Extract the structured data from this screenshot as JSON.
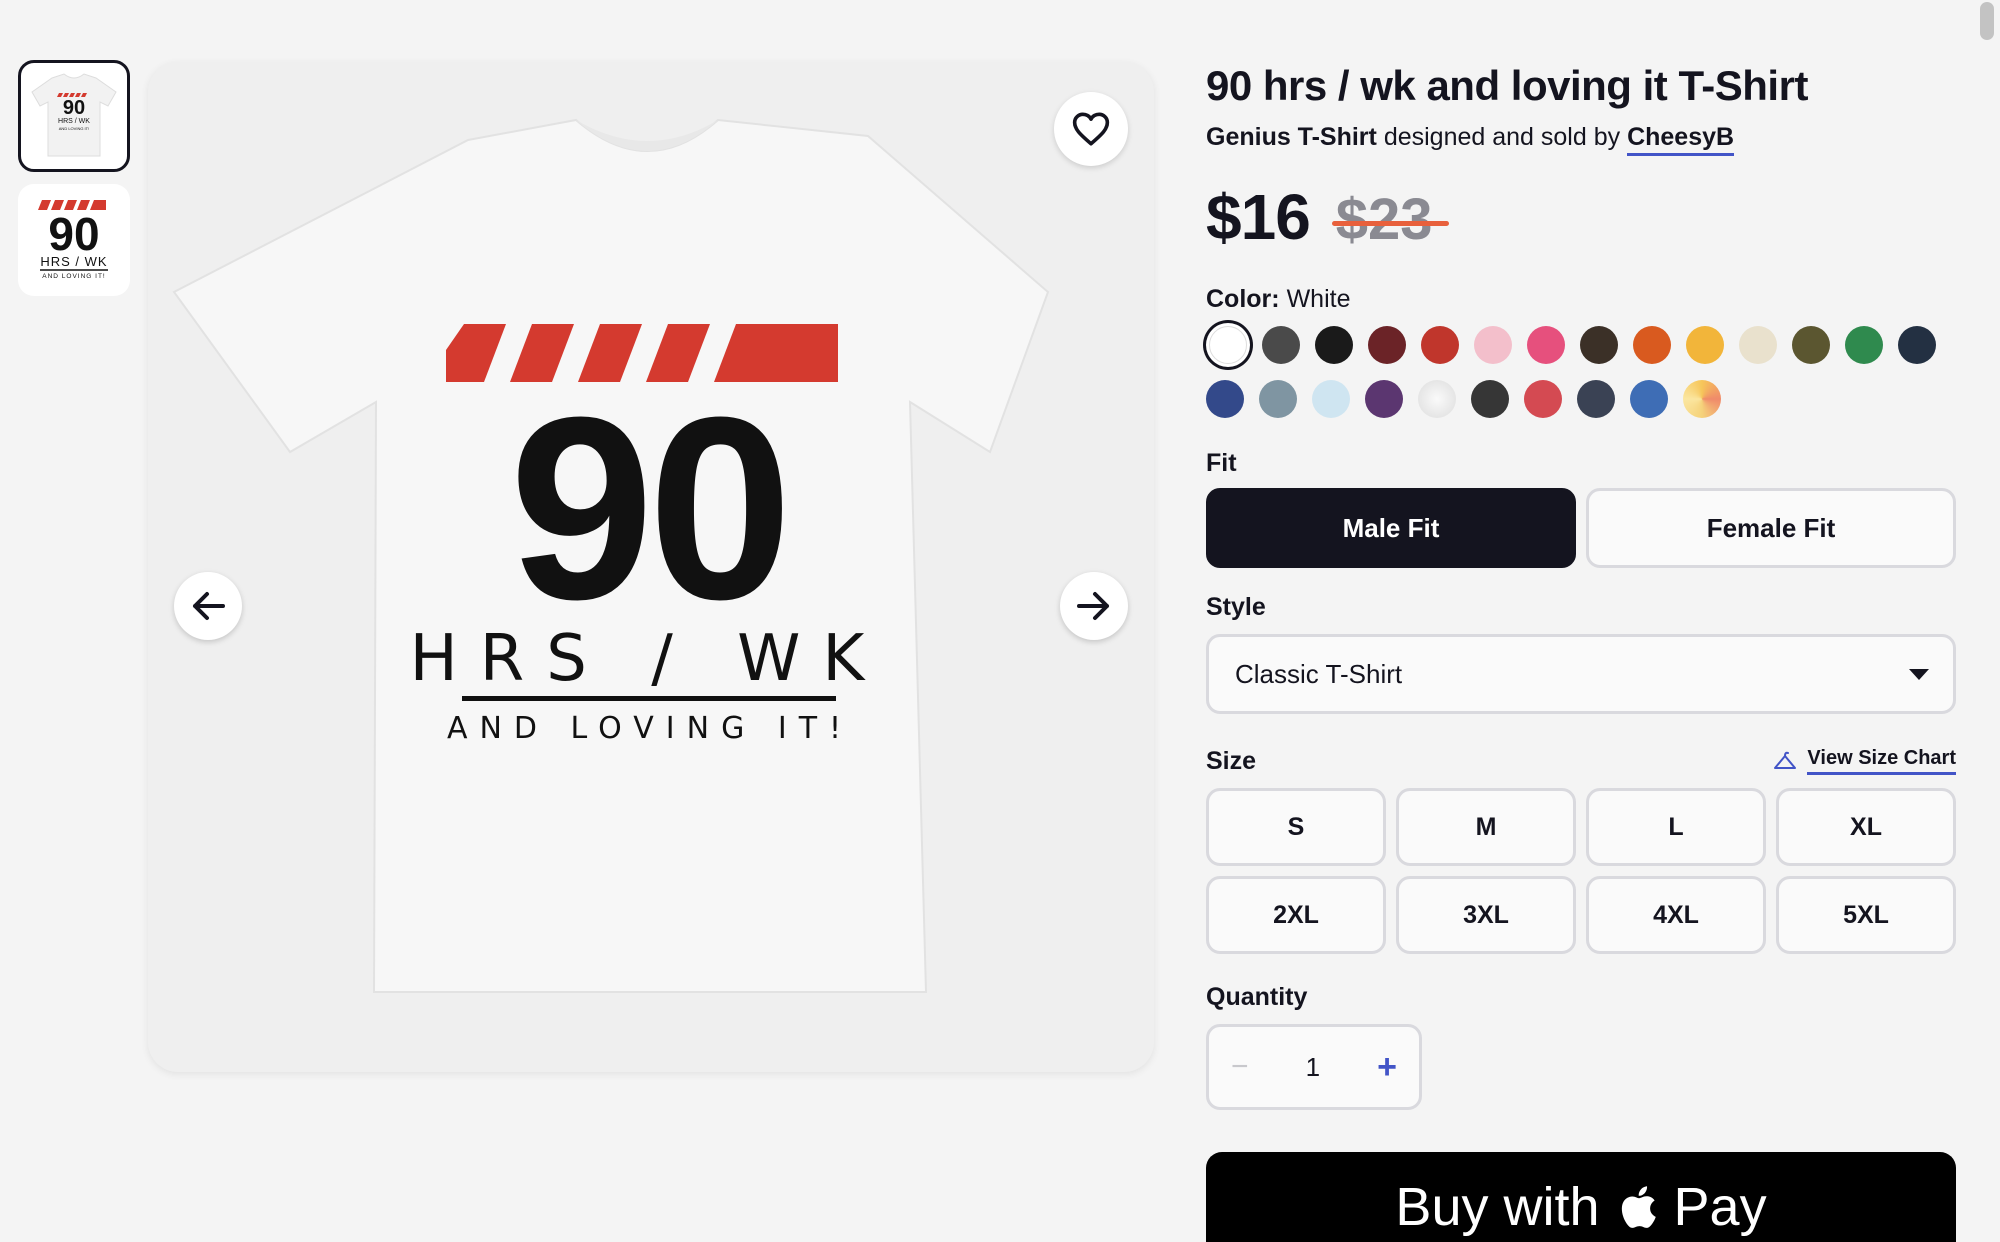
{
  "product": {
    "title": "90 hrs / wk and loving it T-Shirt",
    "product_type": "Genius T-Shirt",
    "designed_by_text": "designed and sold by",
    "artist": "CheesyB",
    "price": "$16",
    "old_price": "$23"
  },
  "design": {
    "number": "90",
    "line1": "HRS / WK",
    "line2": "AND LOVING IT!"
  },
  "color": {
    "label": "Color:",
    "selected": "White",
    "swatches": [
      "#ffffff",
      "#4a4a4a",
      "#1a1a1a",
      "#6b2327",
      "#c0362c",
      "#f3bfcb",
      "#e6507d",
      "#3b3027",
      "#d95a1f",
      "#f2b53a",
      "#e9e1cd",
      "#5b5630",
      "#2f8a4e",
      "#233042",
      "#33498a",
      "#7f95a2",
      "#cfe5f1",
      "#5b3670",
      "#e8e8e8",
      "#363636",
      "#d44a52",
      "#3a4254",
      "#3e6db5",
      "#f5a65a"
    ]
  },
  "fit": {
    "label": "Fit",
    "options": [
      "Male Fit",
      "Female Fit"
    ],
    "selected": "Male Fit"
  },
  "style": {
    "label": "Style",
    "selected": "Classic T-Shirt"
  },
  "size": {
    "label": "Size",
    "chart_link": "View Size Chart",
    "options": [
      "S",
      "M",
      "L",
      "XL",
      "2XL",
      "3XL",
      "4XL",
      "5XL"
    ]
  },
  "quantity": {
    "label": "Quantity",
    "value": "1",
    "minus": "−",
    "plus": "+"
  },
  "applepay": {
    "text_before": "Buy with",
    "text_after": "Pay"
  }
}
